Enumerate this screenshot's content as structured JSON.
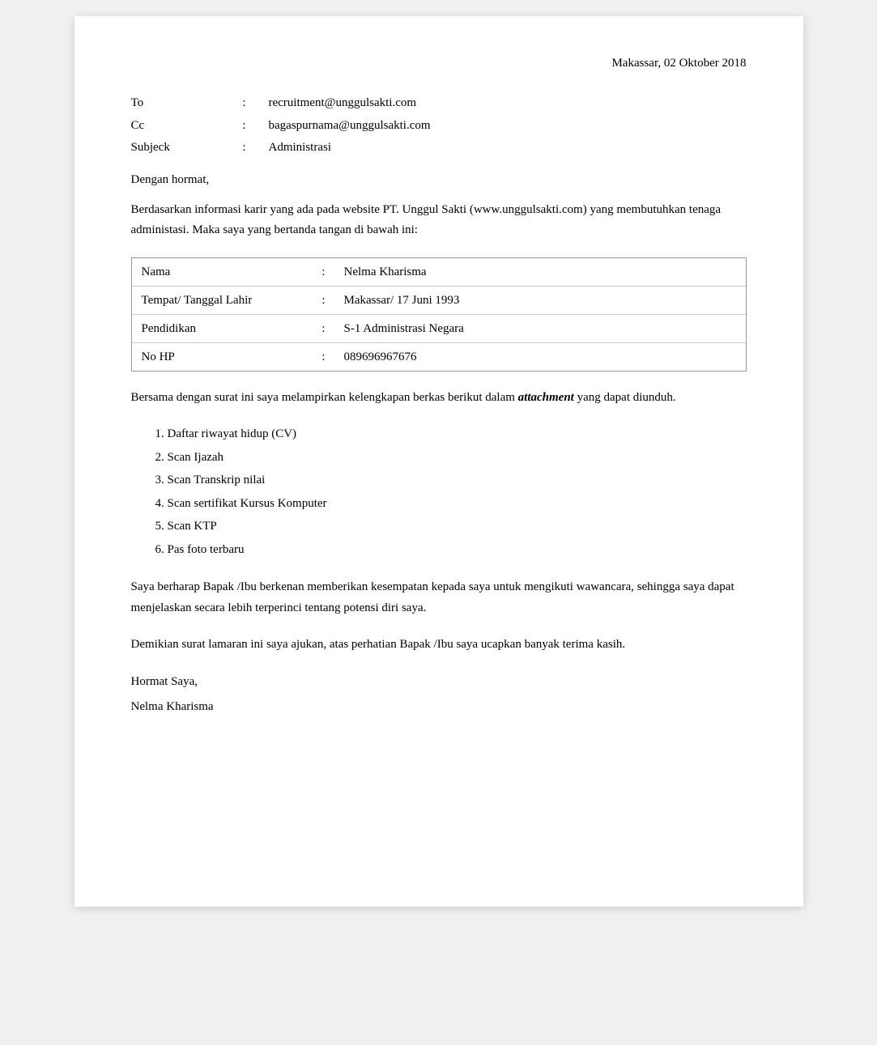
{
  "date": "Makassar, 02 Oktober 2018",
  "header": {
    "to_label": "To",
    "to_colon": ":",
    "to_value": "recruitment@unggulsakti.com",
    "cc_label": "Cc",
    "cc_colon": ":",
    "cc_value": "bagaspurnama@unggulsakti.com",
    "subject_label": "Subjeck",
    "subject_colon": ":",
    "subject_value": "Administrasi"
  },
  "greeting": "Dengan hormat,",
  "intro": "Berdasarkan informasi karir yang ada pada website PT. Unggul Sakti (www.unggulsakti.com) yang membutuhkan tenaga administasi. Maka saya yang bertanda tangan di bawah ini:",
  "info_rows": [
    {
      "label": "Nama",
      "colon": ":",
      "value": "Nelma Kharisma"
    },
    {
      "label": "Tempat/ Tanggal Lahir",
      "colon": ":",
      "value": "Makassar/ 17 Juni 1993"
    },
    {
      "label": "Pendidikan",
      "colon": ":",
      "value": "S-1 Administrasi Negara"
    },
    {
      "label": "No HP",
      "colon": ":",
      "value": "089696967676"
    }
  ],
  "attachment_text_before": "Bersama dengan surat ini saya melampirkan kelengkapan berkas berikut dalam ",
  "attachment_italic": "attachment",
  "attachment_text_after": " yang dapat diunduh.",
  "list_items": [
    "Daftar riwayat hidup (CV)",
    "Scan Ijazah",
    "Scan Transkrip nilai",
    "Scan sertifikat Kursus Komputer",
    "Scan KTP",
    "Pas foto terbaru"
  ],
  "paragraph1": "Saya berharap Bapak /Ibu berkenan memberikan kesempatan kepada saya untuk mengikuti wawancara, sehingga saya dapat menjelaskan secara lebih terperinci tentang potensi diri saya.",
  "paragraph2": "Demikian surat lamaran ini saya ajukan, atas perhatian Bapak /Ibu saya ucapkan banyak terima kasih.",
  "closing": "Hormat Saya,",
  "signature": "Nelma Kharisma"
}
